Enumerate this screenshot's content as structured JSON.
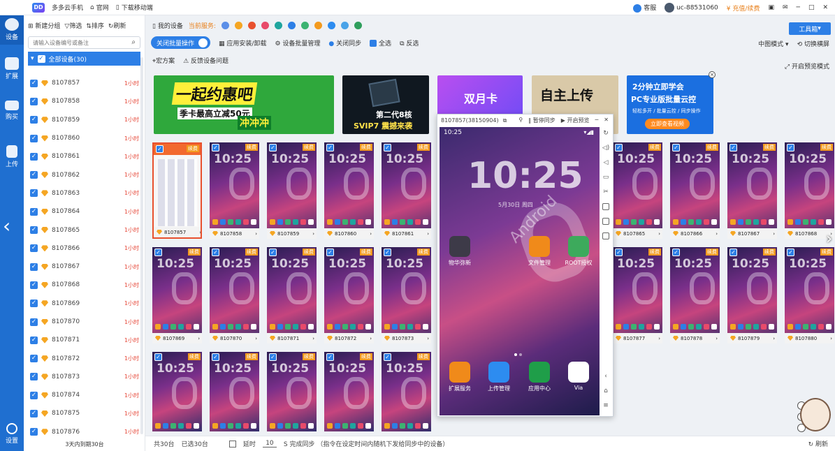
{
  "topbar": {
    "app_name": "多多云手机",
    "official_site": "官网",
    "download_mobile": "下载移动端",
    "service": "客服",
    "user_id": "uc-88531060",
    "recharge": "充值/续费"
  },
  "rail": {
    "items": [
      {
        "label": "设备"
      },
      {
        "label": "扩展"
      },
      {
        "label": "购买"
      },
      {
        "label": "上传"
      },
      {
        "label": "设置"
      }
    ]
  },
  "devpanel": {
    "tools": {
      "new_group": "新建分组",
      "filter": "筛选",
      "sort": "排序",
      "refresh": "刷新"
    },
    "search": {
      "placeholder": "请输入设备编号或备注"
    },
    "all_devices": "全部设备(30)",
    "devices": [
      {
        "id": "8107857",
        "time": "1小时"
      },
      {
        "id": "8107858",
        "time": "1小时"
      },
      {
        "id": "8107859",
        "time": "1小时"
      },
      {
        "id": "8107860",
        "time": "1小时"
      },
      {
        "id": "8107861",
        "time": "1小时"
      },
      {
        "id": "8107862",
        "time": "1小时"
      },
      {
        "id": "8107863",
        "time": "1小时"
      },
      {
        "id": "8107864",
        "time": "1小时"
      },
      {
        "id": "8107865",
        "time": "1小时"
      },
      {
        "id": "8107866",
        "time": "1小时"
      },
      {
        "id": "8107867",
        "time": "1小时"
      },
      {
        "id": "8107868",
        "time": "1小时"
      },
      {
        "id": "8107869",
        "time": "1小时"
      },
      {
        "id": "8107870",
        "time": "1小时"
      },
      {
        "id": "8107871",
        "time": "1小时"
      },
      {
        "id": "8107872",
        "time": "1小时"
      },
      {
        "id": "8107873",
        "time": "1小时"
      },
      {
        "id": "8107874",
        "time": "1小时"
      },
      {
        "id": "8107875",
        "time": "1小时"
      },
      {
        "id": "8107876",
        "time": "1小时"
      }
    ],
    "footer": "3天内到期30台"
  },
  "main": {
    "my_devices": "我的设备",
    "current_service": "当前服务:",
    "toolbox": "工具箱",
    "batch_toggle": "关闭批量操作",
    "app_install": "应用安装/卸载",
    "batch_manage": "设备批量管理",
    "close_sync": "关闭同步",
    "select_all": "全选",
    "invert": "反选",
    "view_mode": "中图模式",
    "switch_portrait": "切换横屏",
    "macro": "宏方案",
    "feedback": "反馈设备问题",
    "open_preview": "开启预览模式"
  },
  "banners": {
    "b1_title": "一起约惠吧",
    "b1_sub": "季卡最高立减50元",
    "b1_cta": "冲冲冲",
    "b2_title": "第二代8核",
    "b2_sub": "SVIP7 震撼来袭",
    "b3_title": "双月卡",
    "b4_title": "自主上传",
    "b5_title1": "2分钟立即学会",
    "b5_title2": "PC专业版批量云控",
    "b5_desc": "轻松多开 / 批量云控 / 同步操作",
    "b5_cta": "立即查看视频"
  },
  "thumbs": {
    "renew": "续费",
    "clock": "10:25",
    "ids": [
      "8107857",
      "8107858",
      "8107859",
      "8107860",
      "8107861",
      "8107865",
      "8107866",
      "8107867",
      "8107868",
      "8107869",
      "8107870",
      "8107871",
      "8107872",
      "8107873",
      "8107877",
      "8107878",
      "8107879",
      "8107880"
    ]
  },
  "phone": {
    "title": "8107857(38150904)",
    "pause_sync": "暂停同步",
    "open_preview": "开启预览",
    "status_time": "10:25",
    "big_clock": "10:25",
    "date": "5月30日 周四",
    "apps": [
      {
        "label": "物华弥新",
        "color": "#3d3a48"
      },
      {
        "label": "文件管理",
        "color": "#f08a1a"
      },
      {
        "label": "ROOT授权",
        "color": "#3daa5c"
      },
      {
        "label": "扩展服务",
        "color": "#f08a1a"
      },
      {
        "label": "上传管理",
        "color": "#2d8cf0"
      },
      {
        "label": "应用中心",
        "color": "#1f9e49"
      },
      {
        "label": "Via",
        "color": "#ffffff"
      }
    ]
  },
  "bottom": {
    "total": "共30台",
    "selected": "已选30台",
    "delay_label": "延时",
    "delay_value": "10",
    "delay_hint": "S 完成同步 （指令在设定时间内随机下发给同步中的设备）",
    "refresh": "刷新"
  },
  "colors": {
    "accent": "#2d7fe6",
    "rail": "#1f6fd0",
    "renew": "#f39a1e",
    "time_red": "#e64a3b"
  }
}
